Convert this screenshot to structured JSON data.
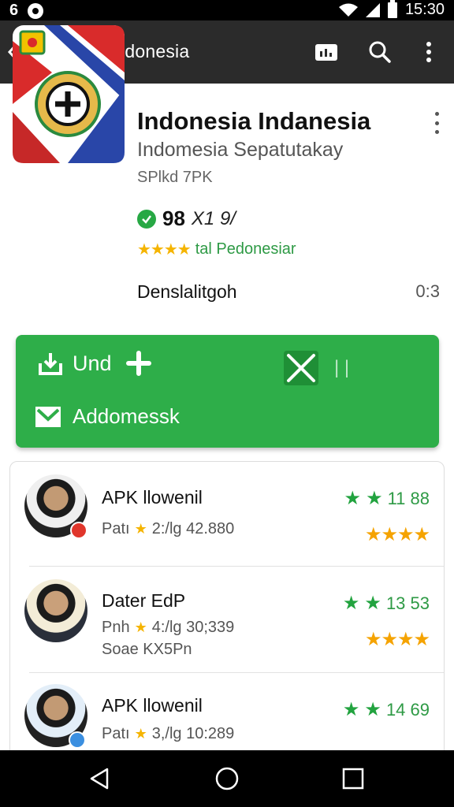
{
  "status_bar": {
    "left_text": "6",
    "time": "15:30"
  },
  "app_bar": {
    "title": "APP Indonesia",
    "icons": [
      "back-icon",
      "avatar",
      "store-icon",
      "search-icon",
      "more-vert-icon"
    ]
  },
  "app": {
    "name": "Indonesia Indanesia",
    "subtitle": "Indomesia Sepatutakay",
    "type": "SPlkd 7PK",
    "score": "98",
    "score_meta": "X1 9/",
    "stars": "★★★★",
    "rating_label": "tal Pedonesiar",
    "desc_label": "Denslalitgoh",
    "desc_value": "0:3"
  },
  "actions": {
    "install_label": "Und",
    "add_label": "Addomessk",
    "divider_marks": "|  |"
  },
  "list": [
    {
      "name": "APK llowenil",
      "sub_prefix": "Patı",
      "sub_value": "2:/lg 42.880",
      "extra": "",
      "rate_value": "11 88",
      "orange_stars": "★★★★",
      "badge_color": "#e0362b"
    },
    {
      "name": "Dater EdP",
      "sub_prefix": "Pnh",
      "sub_value": "4:/lg 30;339",
      "extra": "Soae KX5Pn",
      "rate_value": "13 53",
      "orange_stars": "★★★★",
      "badge_color": ""
    },
    {
      "name": "APK llowenil",
      "sub_prefix": "Patı",
      "sub_value": "3,/lg 10:289",
      "extra": "",
      "rate_value": "14 69",
      "orange_stars": "",
      "badge_color": "#3b8fe0"
    }
  ],
  "colors": {
    "primary_green": "#2eae49",
    "star_orange": "#f5a300",
    "appbar": "#2b2b2b"
  }
}
